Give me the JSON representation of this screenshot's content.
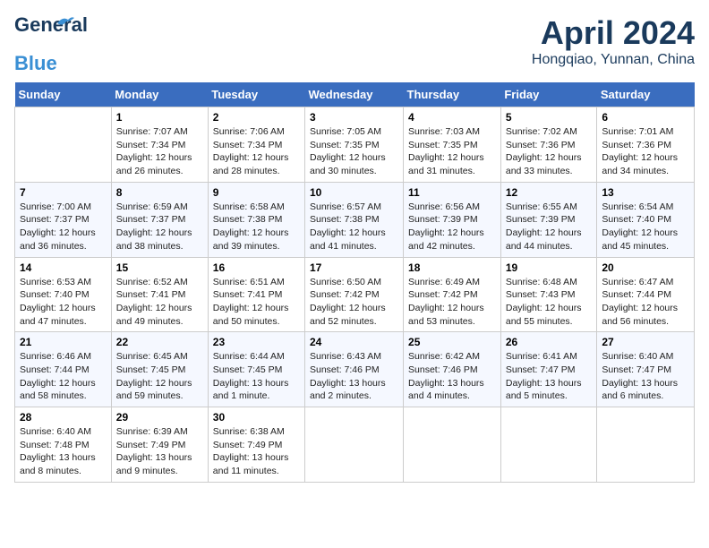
{
  "header": {
    "logo_line1": "General",
    "logo_line2": "Blue",
    "month_title": "April 2024",
    "location": "Hongqiao, Yunnan, China"
  },
  "calendar": {
    "days_of_week": [
      "Sunday",
      "Monday",
      "Tuesday",
      "Wednesday",
      "Thursday",
      "Friday",
      "Saturday"
    ],
    "weeks": [
      [
        {
          "day": "",
          "info": ""
        },
        {
          "day": "1",
          "info": "Sunrise: 7:07 AM\nSunset: 7:34 PM\nDaylight: 12 hours\nand 26 minutes."
        },
        {
          "day": "2",
          "info": "Sunrise: 7:06 AM\nSunset: 7:34 PM\nDaylight: 12 hours\nand 28 minutes."
        },
        {
          "day": "3",
          "info": "Sunrise: 7:05 AM\nSunset: 7:35 PM\nDaylight: 12 hours\nand 30 minutes."
        },
        {
          "day": "4",
          "info": "Sunrise: 7:03 AM\nSunset: 7:35 PM\nDaylight: 12 hours\nand 31 minutes."
        },
        {
          "day": "5",
          "info": "Sunrise: 7:02 AM\nSunset: 7:36 PM\nDaylight: 12 hours\nand 33 minutes."
        },
        {
          "day": "6",
          "info": "Sunrise: 7:01 AM\nSunset: 7:36 PM\nDaylight: 12 hours\nand 34 minutes."
        }
      ],
      [
        {
          "day": "7",
          "info": "Sunrise: 7:00 AM\nSunset: 7:37 PM\nDaylight: 12 hours\nand 36 minutes."
        },
        {
          "day": "8",
          "info": "Sunrise: 6:59 AM\nSunset: 7:37 PM\nDaylight: 12 hours\nand 38 minutes."
        },
        {
          "day": "9",
          "info": "Sunrise: 6:58 AM\nSunset: 7:38 PM\nDaylight: 12 hours\nand 39 minutes."
        },
        {
          "day": "10",
          "info": "Sunrise: 6:57 AM\nSunset: 7:38 PM\nDaylight: 12 hours\nand 41 minutes."
        },
        {
          "day": "11",
          "info": "Sunrise: 6:56 AM\nSunset: 7:39 PM\nDaylight: 12 hours\nand 42 minutes."
        },
        {
          "day": "12",
          "info": "Sunrise: 6:55 AM\nSunset: 7:39 PM\nDaylight: 12 hours\nand 44 minutes."
        },
        {
          "day": "13",
          "info": "Sunrise: 6:54 AM\nSunset: 7:40 PM\nDaylight: 12 hours\nand 45 minutes."
        }
      ],
      [
        {
          "day": "14",
          "info": "Sunrise: 6:53 AM\nSunset: 7:40 PM\nDaylight: 12 hours\nand 47 minutes."
        },
        {
          "day": "15",
          "info": "Sunrise: 6:52 AM\nSunset: 7:41 PM\nDaylight: 12 hours\nand 49 minutes."
        },
        {
          "day": "16",
          "info": "Sunrise: 6:51 AM\nSunset: 7:41 PM\nDaylight: 12 hours\nand 50 minutes."
        },
        {
          "day": "17",
          "info": "Sunrise: 6:50 AM\nSunset: 7:42 PM\nDaylight: 12 hours\nand 52 minutes."
        },
        {
          "day": "18",
          "info": "Sunrise: 6:49 AM\nSunset: 7:42 PM\nDaylight: 12 hours\nand 53 minutes."
        },
        {
          "day": "19",
          "info": "Sunrise: 6:48 AM\nSunset: 7:43 PM\nDaylight: 12 hours\nand 55 minutes."
        },
        {
          "day": "20",
          "info": "Sunrise: 6:47 AM\nSunset: 7:44 PM\nDaylight: 12 hours\nand 56 minutes."
        }
      ],
      [
        {
          "day": "21",
          "info": "Sunrise: 6:46 AM\nSunset: 7:44 PM\nDaylight: 12 hours\nand 58 minutes."
        },
        {
          "day": "22",
          "info": "Sunrise: 6:45 AM\nSunset: 7:45 PM\nDaylight: 12 hours\nand 59 minutes."
        },
        {
          "day": "23",
          "info": "Sunrise: 6:44 AM\nSunset: 7:45 PM\nDaylight: 13 hours\nand 1 minute."
        },
        {
          "day": "24",
          "info": "Sunrise: 6:43 AM\nSunset: 7:46 PM\nDaylight: 13 hours\nand 2 minutes."
        },
        {
          "day": "25",
          "info": "Sunrise: 6:42 AM\nSunset: 7:46 PM\nDaylight: 13 hours\nand 4 minutes."
        },
        {
          "day": "26",
          "info": "Sunrise: 6:41 AM\nSunset: 7:47 PM\nDaylight: 13 hours\nand 5 minutes."
        },
        {
          "day": "27",
          "info": "Sunrise: 6:40 AM\nSunset: 7:47 PM\nDaylight: 13 hours\nand 6 minutes."
        }
      ],
      [
        {
          "day": "28",
          "info": "Sunrise: 6:40 AM\nSunset: 7:48 PM\nDaylight: 13 hours\nand 8 minutes."
        },
        {
          "day": "29",
          "info": "Sunrise: 6:39 AM\nSunset: 7:49 PM\nDaylight: 13 hours\nand 9 minutes."
        },
        {
          "day": "30",
          "info": "Sunrise: 6:38 AM\nSunset: 7:49 PM\nDaylight: 13 hours\nand 11 minutes."
        },
        {
          "day": "",
          "info": ""
        },
        {
          "day": "",
          "info": ""
        },
        {
          "day": "",
          "info": ""
        },
        {
          "day": "",
          "info": ""
        }
      ]
    ]
  }
}
